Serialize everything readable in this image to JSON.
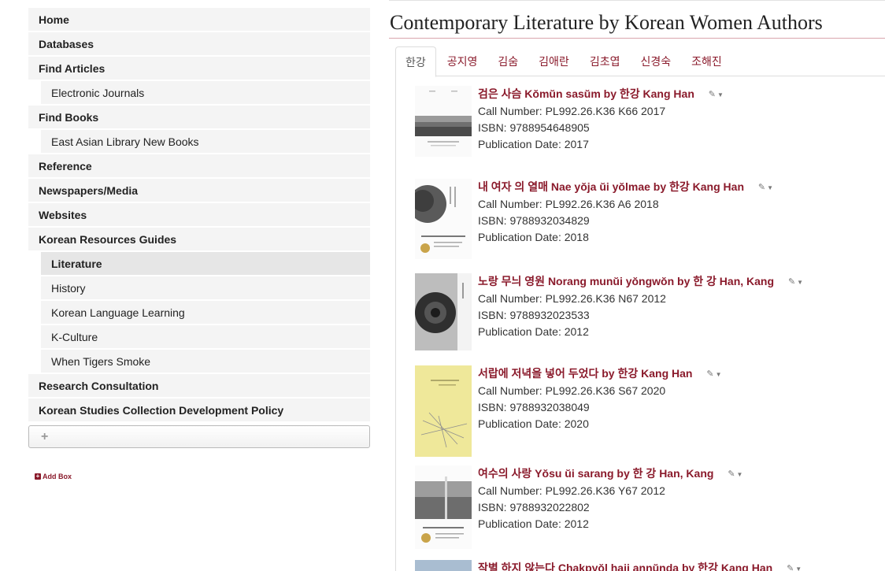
{
  "sidebar": {
    "items": [
      {
        "label": "Home",
        "level": "top"
      },
      {
        "label": "Databases",
        "level": "top"
      },
      {
        "label": "Find Articles",
        "level": "top"
      },
      {
        "label": "Electronic Journals",
        "level": "sub"
      },
      {
        "label": "Find Books",
        "level": "top"
      },
      {
        "label": "East Asian Library New Books",
        "level": "sub"
      },
      {
        "label": "Reference",
        "level": "top"
      },
      {
        "label": "Newspapers/Media",
        "level": "top"
      },
      {
        "label": "Websites",
        "level": "top"
      },
      {
        "label": "Korean Resources Guides",
        "level": "top"
      },
      {
        "label": "Literature",
        "level": "sub",
        "active": true
      },
      {
        "label": "History",
        "level": "sub"
      },
      {
        "label": "Korean Language Learning",
        "level": "sub"
      },
      {
        "label": "K-Culture",
        "level": "sub"
      },
      {
        "label": "When Tigers Smoke",
        "level": "sub"
      },
      {
        "label": "Research Consultation",
        "level": "top"
      },
      {
        "label": "Korean Studies Collection Development Policy",
        "level": "top"
      }
    ],
    "add_page_symbol": "+",
    "add_box_label": "Add Box"
  },
  "main": {
    "title": "Contemporary Literature by Korean Women Authors",
    "tabs": [
      {
        "label": "한강",
        "active": true
      },
      {
        "label": "공지영"
      },
      {
        "label": "김숨"
      },
      {
        "label": "김애란"
      },
      {
        "label": "김초엽"
      },
      {
        "label": "신경숙"
      },
      {
        "label": "조해진"
      }
    ],
    "books": [
      {
        "title": "검은 사슴 Kŏmŭn sasŭm by 한강 Kang Han",
        "call": "Call Number: PL992.26.K36 K66 2017",
        "isbn": "ISBN: 9788954648905",
        "date": "Publication Date: 2017"
      },
      {
        "title": "내 여자 의 열매 Nae yŏja ŭi yŏlmae by 한강 Kang Han",
        "call": "Call Number: PL992.26.K36 A6 2018",
        "isbn": "ISBN: 9788932034829",
        "date": "Publication Date: 2018"
      },
      {
        "title": "노랑 무늬 영원 Norang munŭi yŏngwŏn by 한 강 Han, Kang",
        "call": "Call Number: PL992.26.K36 N67 2012",
        "isbn": "ISBN: 9788932023533",
        "date": "Publication Date: 2012"
      },
      {
        "title": "서랍에 저녁을 넣어 두었다 by 한강 Kang Han",
        "call": "Call Number: PL992.26.K36 S67 2020",
        "isbn": "ISBN: 9788932038049",
        "date": "Publication Date: 2020"
      },
      {
        "title": "여수의 사랑 Yŏsu ŭi sarang by 한 강 Han, Kang",
        "call": "Call Number: PL992.26.K36 Y67 2012",
        "isbn": "ISBN: 9788932022802",
        "date": "Publication Date: 2012"
      },
      {
        "title": "작별 하지 않는다 Chakpyŏl haji annŭnda by 한강 Kang Han",
        "call": "",
        "isbn": "",
        "date": ""
      }
    ]
  },
  "colors": {
    "accent": "#8a1a2b",
    "nav_bg": "#f4f4f4",
    "nav_active": "#e6e6e6"
  }
}
